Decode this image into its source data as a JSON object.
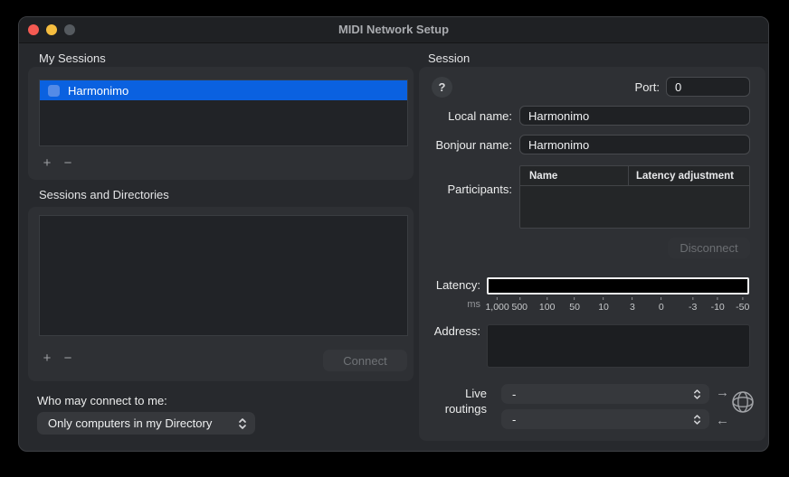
{
  "window": {
    "title": "MIDI Network Setup"
  },
  "icons": {
    "add": "+",
    "remove": "−",
    "forward_arrow": "→",
    "back_arrow": "←"
  },
  "colors": {
    "accent_blue": "#0a61e0",
    "traffic_red": "#f45a52",
    "traffic_yellow": "#f5bd3f",
    "traffic_gray": "#555a5f",
    "panel": "#2e3034",
    "window_bg": "#27292d"
  },
  "left": {
    "my_sessions": {
      "label": "My Sessions",
      "rows": [
        {
          "name": "Harmonimo",
          "checked": false,
          "selected": true
        }
      ]
    },
    "directories": {
      "label": "Sessions and Directories",
      "connect_label": "Connect"
    },
    "who": {
      "label": "Who may connect to me:",
      "value": "Only computers in my Directory"
    }
  },
  "session": {
    "label": "Session",
    "help_label": "?",
    "port": {
      "label": "Port:",
      "value": "0"
    },
    "local_name": {
      "label": "Local name:",
      "value": "Harmonimo"
    },
    "bonjour_name": {
      "label": "Bonjour name:",
      "value": "Harmonimo"
    },
    "participants": {
      "label": "Participants:",
      "columns": [
        "Name",
        "Latency adjustment"
      ],
      "rows": [],
      "disconnect_label": "Disconnect"
    },
    "latency": {
      "label": "Latency:",
      "unit": "ms",
      "ticks": [
        "1,000",
        "500",
        "100",
        "50",
        "10",
        "3",
        "0",
        "-3",
        "-10",
        "-50"
      ]
    },
    "address": {
      "label": "Address:"
    },
    "live_routings": {
      "label_line1": "Live",
      "label_line2": "routings",
      "upper_value": "-",
      "lower_value": "-"
    }
  }
}
